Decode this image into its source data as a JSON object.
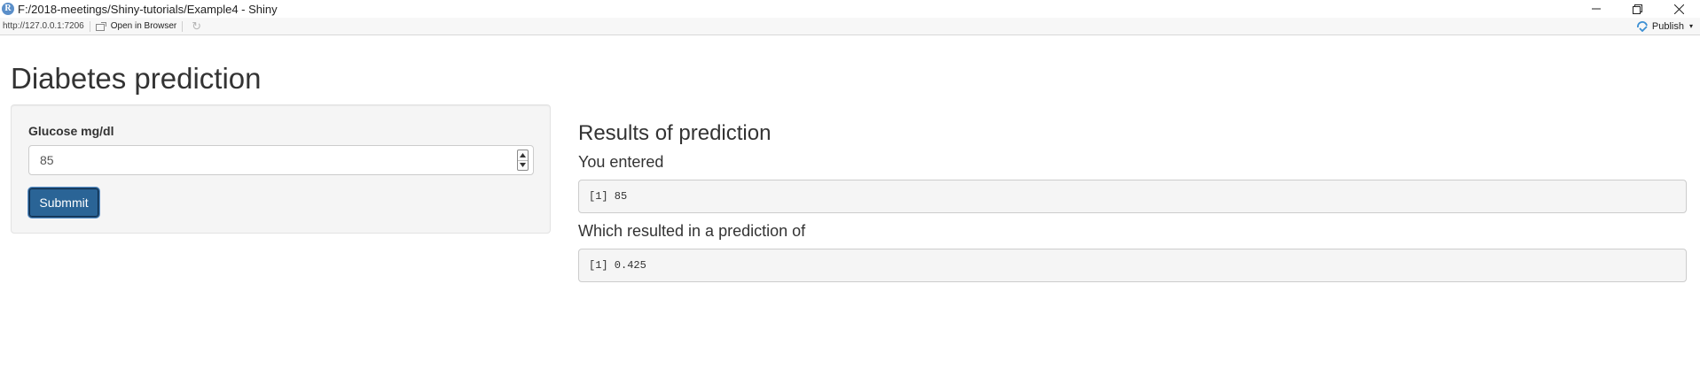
{
  "window": {
    "title": "F:/2018-meetings/Shiny-tutorials/Example4 - Shiny",
    "app_icon": "R"
  },
  "addressbar": {
    "url": "http://127.0.0.1:7206",
    "open_in_browser": "Open in Browser",
    "publish": "Publish"
  },
  "page": {
    "title": "Diabetes prediction"
  },
  "sidebar": {
    "input_label": "Glucose mg/dl",
    "input_value": "85",
    "submit_label": "Submmit"
  },
  "results": {
    "title": "Results of prediction",
    "entered_label": "You entered",
    "entered_output": "[1] 85",
    "prediction_label": "Which resulted in a prediction of",
    "prediction_output": "[1] 0.425"
  },
  "colors": {
    "button_bg": "#2a6496",
    "well_bg": "#f5f5f5",
    "pre_bg": "#f5f5f5"
  }
}
